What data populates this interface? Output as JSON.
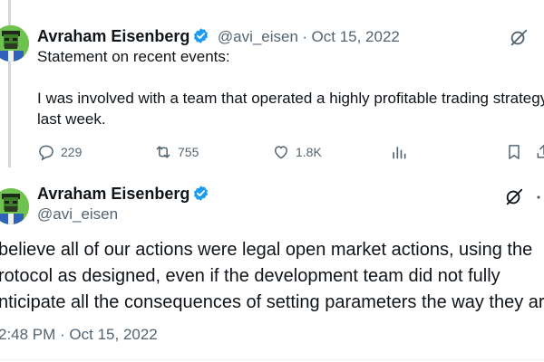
{
  "thread": {
    "first_tweet": {
      "author_name": "Avraham Eisenberg",
      "handle": "@avi_eisen",
      "separator": "·",
      "date": "Oct 15, 2022",
      "lines": [
        "Statement on recent events:",
        "I was involved with a team that operated a highly profitable trading strategy",
        "last week."
      ],
      "actions": {
        "replies": "229",
        "retweets": "755",
        "likes": "1.8K"
      },
      "icons": [
        "reply-icon",
        "retweet-icon",
        "like-icon",
        "views-icon",
        "bookmark-icon",
        "share-icon",
        "grok-icon"
      ]
    },
    "second_tweet": {
      "author_name": "Avraham Eisenberg",
      "handle": "@avi_eisen",
      "lines": [
        "believe all of our actions were legal open market actions, using the",
        "rotocol as designed, even if the development team did not fully",
        "nticipate all the consequences of setting parameters the way they are."
      ],
      "timestamp": "2:48 PM · Oct 15, 2022",
      "icons": [
        "grok-icon",
        "more-icon"
      ]
    }
  },
  "colors": {
    "text": "#0f1419",
    "secondary": "#536471",
    "verified": "#1d9bf0",
    "thread_line": "#cfd9de"
  }
}
